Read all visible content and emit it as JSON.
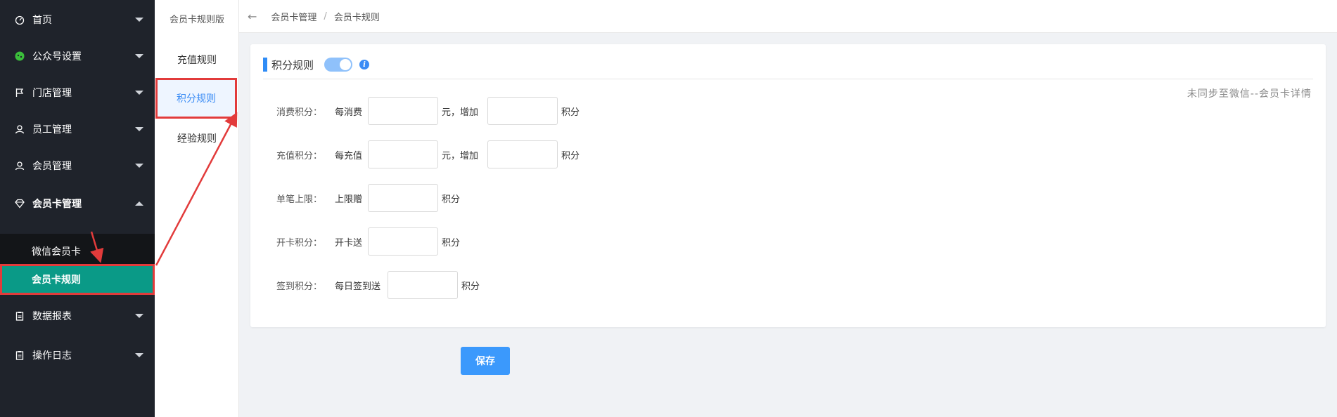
{
  "sidebar": {
    "items": [
      {
        "label": "首页",
        "icon": "dashboard-icon"
      },
      {
        "label": "公众号设置",
        "icon": "wechat-icon"
      },
      {
        "label": "门店管理",
        "icon": "flag-icon"
      },
      {
        "label": "员工管理",
        "icon": "user-icon"
      },
      {
        "label": "会员管理",
        "icon": "user-icon"
      },
      {
        "label": "会员卡管理",
        "icon": "diamond-icon"
      },
      {
        "label": "数据报表",
        "icon": "clipboard-icon"
      },
      {
        "label": "操作日志",
        "icon": "clipboard-icon"
      }
    ],
    "submenu": [
      {
        "label": "微信会员卡"
      },
      {
        "label": "会员卡规则"
      }
    ]
  },
  "subnav": {
    "title": "会员卡规则版",
    "items": [
      {
        "label": "充值规则"
      },
      {
        "label": "积分规则"
      },
      {
        "label": "经验规则"
      }
    ]
  },
  "breadcrumb": {
    "back": "←",
    "level1": "会员卡管理",
    "sep": "/",
    "level2": "会员卡规则"
  },
  "card": {
    "title": "积分规则",
    "toggle_on": true,
    "info": "i",
    "sync_note": "未同步至微信--会员卡详情",
    "rows": [
      {
        "label": "消费积分：",
        "pre": "每消费",
        "mid": "元，增加",
        "post": "积分"
      },
      {
        "label": "充值积分：",
        "pre": "每充值",
        "mid": "元，增加",
        "post": "积分"
      },
      {
        "label": "单笔上限：",
        "pre": "上限赠",
        "post": "积分"
      },
      {
        "label": "开卡积分：",
        "pre": "开卡送",
        "post": "积分"
      },
      {
        "label": "签到积分：",
        "pre": "每日签到送",
        "post": "积分"
      }
    ]
  },
  "save_label": "保存",
  "colors": {
    "sidebar_bg": "#1f232b",
    "active_green": "#0a9a87",
    "accent_blue": "#3b99fc",
    "annotation_red": "#e23b3b"
  }
}
